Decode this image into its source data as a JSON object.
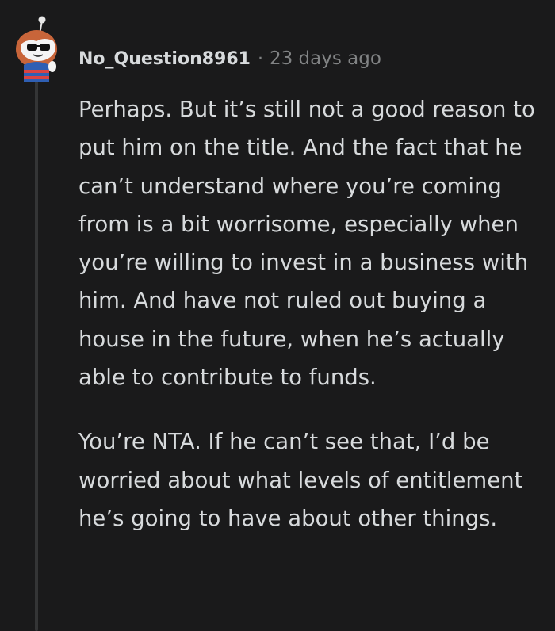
{
  "comment": {
    "username": "No_Question8961",
    "separator": "·",
    "timestamp": "23 days ago",
    "paragraphs": [
      "Perhaps. But it’s still not a good reason to put him on the title. And the fact that he can’t understand where you’re coming from is a bit worrisome, especially when you’re willing to invest in a business with him. And have not ruled out buying a house in the future, when he’s actually able to contribute to funds.",
      "You’re NTA. If he can’t see that, I’d be worried about what levels of entitlement he’s going to have about other things."
    ]
  },
  "colors": {
    "background": "#1a1a1b",
    "text": "#d7dadc",
    "meta": "#818384",
    "thread_line": "#343536"
  },
  "icons": {
    "avatar": "reddit-snoo-avatar"
  }
}
